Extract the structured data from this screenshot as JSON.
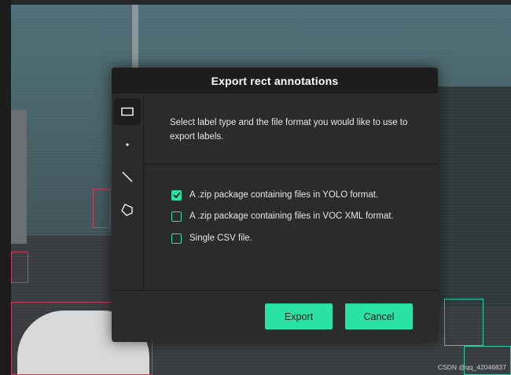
{
  "dialog": {
    "title": "Export rect annotations",
    "description": "Select label type and the file format you would like to use to export labels.",
    "options": [
      {
        "label": "A .zip package containing files in YOLO format.",
        "checked": true
      },
      {
        "label": "A .zip package containing files in VOC XML format.",
        "checked": false
      },
      {
        "label": "Single CSV file.",
        "checked": false
      }
    ],
    "export_label": "Export",
    "cancel_label": "Cancel"
  },
  "sidebar": {
    "tools": [
      {
        "icon": "rectangle-icon",
        "active": true
      },
      {
        "icon": "point-icon",
        "active": false
      },
      {
        "icon": "line-icon",
        "active": false
      },
      {
        "icon": "polygon-icon",
        "active": false
      }
    ]
  },
  "watermark": "CSDN @qq_42046837",
  "colors": {
    "accent": "#2be2a6",
    "dialog_bg": "#2b2b2b",
    "header_bg": "#1d1d1d"
  }
}
